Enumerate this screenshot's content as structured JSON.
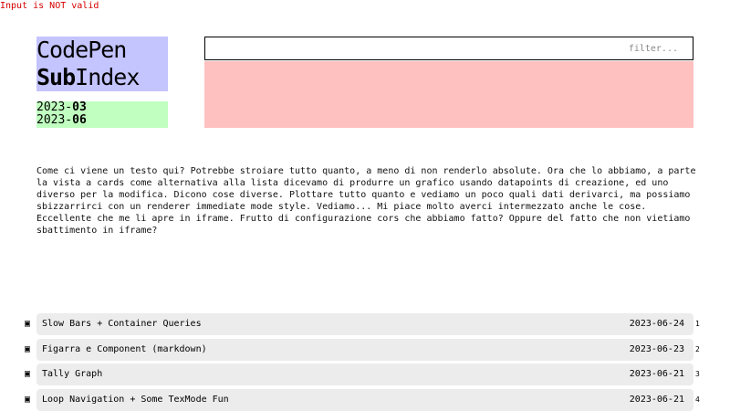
{
  "error": "Input is NOT valid",
  "title": {
    "line1": "CodePen",
    "line2_bold": "Sub",
    "line2_rest": "Index"
  },
  "dates": {
    "from_year": "2023-",
    "from_month": "03",
    "to_year": "2023-",
    "to_month": "06"
  },
  "filter": {
    "placeholder": "filter...",
    "value": ""
  },
  "description": "Come ci viene un testo qui? Potrebbe stroiare tutto quanto, a meno di non renderlo absolute. Ora che lo abbiamo, a parte\nla vista a cards come alternativa alla lista dicevamo di produrre un grafico usando datapoints di creazione, ed uno\ndiverso per la modifica. Dicono cose diverse. Plottare tutto quanto e vediamo un poco quali dati derivarci, ma possiamo\nsbizzarrirci con un renderer immediate mode style. Vediamo... Mi piace molto averci intermezzato anche le cose.\nEccellente che me li apre in iframe. Frutto di configurazione cors che abbiamo fatto? Oppure del fatto che non vietiamo\nsbattimento in iframe?",
  "items": [
    {
      "marker": "▣",
      "title": "Slow Bars + Container Queries",
      "date": "2023-06-24",
      "index": "1"
    },
    {
      "marker": "▣",
      "title": "Figarra e Component (markdown)",
      "date": "2023-06-23",
      "index": "2"
    },
    {
      "marker": "▣",
      "title": "Tally Graph",
      "date": "2023-06-21",
      "index": "3"
    },
    {
      "marker": "▣",
      "title": "Loop Navigation + Some TexMode Fun",
      "date": "2023-06-21",
      "index": "4"
    }
  ]
}
